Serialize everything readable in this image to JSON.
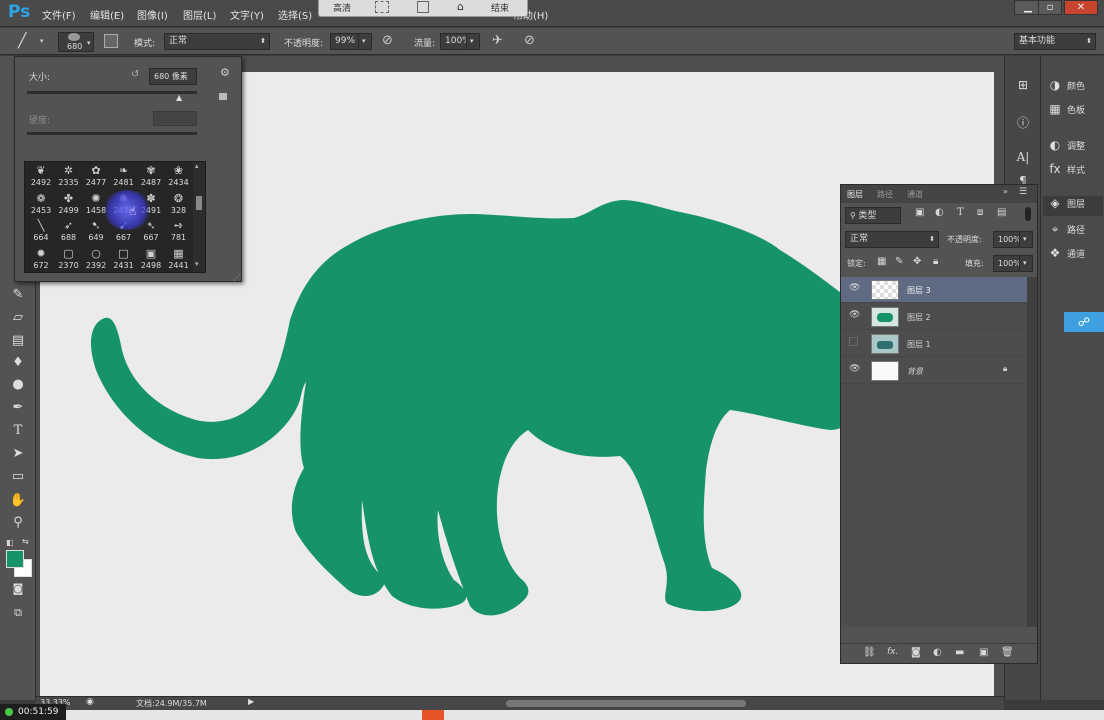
{
  "app": {
    "logo": "Ps"
  },
  "menu": [
    "文件(F)",
    "编辑(E)",
    "图像(I)",
    "图层(L)",
    "文字(Y)",
    "选择(S)",
    "帮助(H)"
  ],
  "overlay_toolbar": {
    "quality_label": "高清",
    "end_label": "结束"
  },
  "options": {
    "brush_size": "680",
    "mode_label": "模式:",
    "mode_value": "正常",
    "opacity_label": "不透明度:",
    "opacity_value": "99%",
    "flow_label": "流量:",
    "flow_value": "100%",
    "workspace": "基本功能"
  },
  "brush_popup": {
    "size_label": "大小:",
    "size_value": "680 像素",
    "hardness_label": "硬度:",
    "brushes": [
      "2492",
      "2335",
      "2477",
      "2481",
      "2487",
      "2434",
      "2453",
      "2499",
      "1458",
      "2471",
      "2491",
      "328",
      "664",
      "688",
      "649",
      "667",
      "667",
      "781",
      "672",
      "2370",
      "2392",
      "2431",
      "2498",
      "2441"
    ]
  },
  "right_panels": [
    {
      "icon": "color-icon",
      "label": "颜色"
    },
    {
      "icon": "swatches-icon",
      "label": "色板"
    },
    {
      "icon": "adjustments-icon",
      "label": "调整"
    },
    {
      "icon": "styles-icon",
      "label": "样式"
    },
    {
      "icon": "layers-icon",
      "label": "图层"
    },
    {
      "icon": "paths-icon",
      "label": "路径"
    },
    {
      "icon": "channels-icon",
      "label": "通道"
    }
  ],
  "layers_panel": {
    "tabs": [
      "图层",
      "路径",
      "通道"
    ],
    "filter_label": "类型",
    "blend_mode": "正常",
    "opacity_label": "不透明度:",
    "opacity_value": "100%",
    "lock_label": "锁定:",
    "fill_label": "填充:",
    "fill_value": "100%",
    "layers": [
      {
        "name": "图层 3",
        "visible": true,
        "selected": true
      },
      {
        "name": "图层 2",
        "visible": true,
        "selected": false
      },
      {
        "name": "图层 1",
        "visible": false,
        "selected": false
      },
      {
        "name": "背景",
        "visible": true,
        "selected": false,
        "locked": true
      }
    ]
  },
  "status": {
    "zoom": "33.33%",
    "doc_info": "文档:24.9M/35.7M",
    "timer": "00:51:59"
  },
  "colors": {
    "foreground": "#179467",
    "background": "#ffffff",
    "shape": "#179467"
  }
}
